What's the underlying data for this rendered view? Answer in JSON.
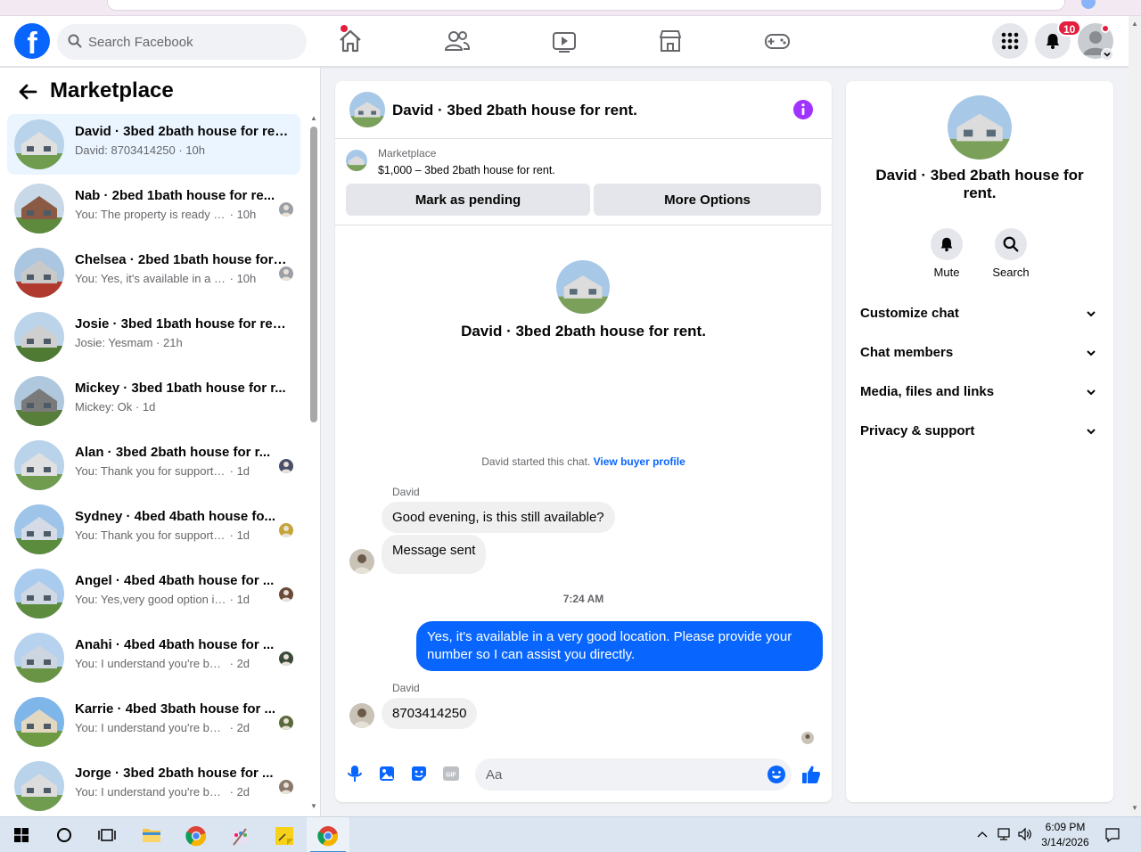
{
  "topnav": {
    "search_placeholder": "Search Facebook",
    "notification_count": "10",
    "colors": {
      "brand": "#0866ff",
      "badge": "#e41e3f"
    }
  },
  "sidebar": {
    "title": "Marketplace",
    "chats": [
      {
        "title": "David · 3bed 2bath house for rent.",
        "message": "David: 8703414250",
        "time": "10h",
        "active": true
      },
      {
        "title": "Nab · 2bed 1bath house for re...",
        "message": "You: The property is ready and ...",
        "time": "10h"
      },
      {
        "title": "Chelsea · 2bed 1bath house for r...",
        "message": "You: Yes, it's available in a very go...",
        "time": "10h"
      },
      {
        "title": "Josie · 3bed 1bath house for rent.",
        "message": "Josie: Yesmam",
        "time": "21h"
      },
      {
        "title": "Mickey · 3bed 1bath house for r...",
        "message": "Mickey: Ok",
        "time": "1d"
      },
      {
        "title": "Alan · 3bed 2bath house for r...",
        "message": "You: Thank you for supporting t...",
        "time": "1d"
      },
      {
        "title": "Sydney · 4bed 4bath house fo...",
        "message": "You: Thank you for supporting t...",
        "time": "1d"
      },
      {
        "title": "Angel · 4bed 4bath house for ...",
        "message": "You: Yes,very good option in pri...",
        "time": "1d"
      },
      {
        "title": "Anahi · 4bed 4bath house for ...",
        "message": "You: I understand you're busy. It'...",
        "time": "2d"
      },
      {
        "title": "Karrie · 4bed 3bath house for ...",
        "message": "You: I understand you're busy. It'...",
        "time": "2d"
      },
      {
        "title": "Jorge · 3bed 2bath house for ...",
        "message": "You: I understand you're busy. It'...",
        "time": "2d"
      }
    ]
  },
  "chat": {
    "title": "David · 3bed 2bath house for rent.",
    "marketplace_label": "Marketplace",
    "listing": "$1,000 – 3bed 2bath house for rent.",
    "mark_pending": "Mark as pending",
    "more_options": "More Options",
    "intro_title": "David · 3bed 2bath house for rent.",
    "started_text": "David started this chat.",
    "view_buyer": "View buyer profile",
    "messages": [
      {
        "sender": "David",
        "text": "Good evening, is this still available?"
      },
      {
        "text": "Message sent"
      },
      {
        "timestamp": "7:24 AM"
      },
      {
        "text": "Yes, it's available in a very good location. Please provide your number so I can assist you directly.",
        "outgoing": true
      },
      {
        "sender": "David",
        "text": "8703414250"
      }
    ],
    "composer_placeholder": "Aa"
  },
  "rpanel": {
    "title": "David · 3bed 2bath house for rent.",
    "mute": "Mute",
    "search": "Search",
    "sections": [
      "Customize chat",
      "Chat members",
      "Media, files and links",
      "Privacy & support"
    ]
  },
  "taskbar": {
    "time": "6:09 PM",
    "date": "3/14/2026"
  }
}
